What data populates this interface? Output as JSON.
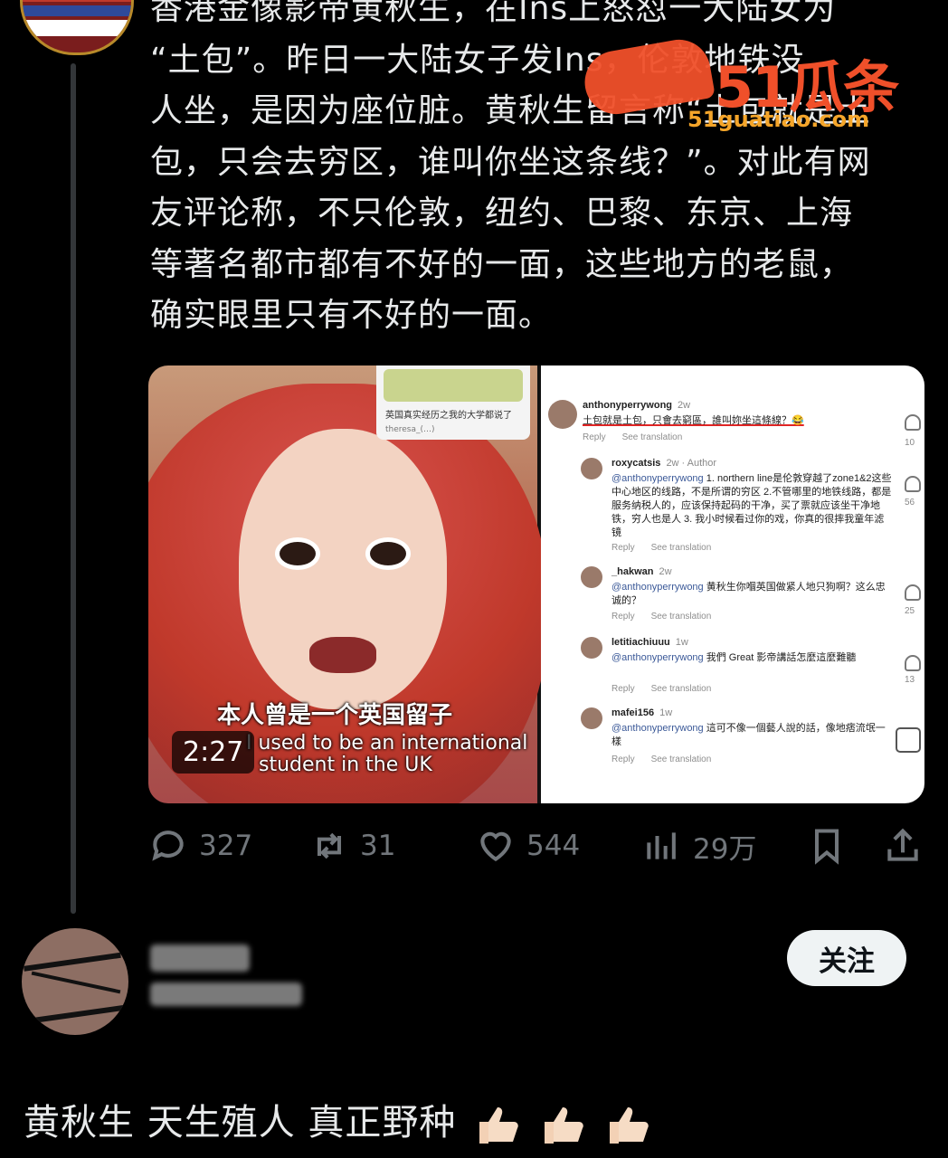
{
  "post": {
    "lines": [
      "香港金像影帝黄秋生，在Ins上怒怼一大陆女为",
      "“土包”。昨日一大陆女子发Ins，伦敦地铁没",
      "人坐，是因为座位脏。黄秋生留言称“土包就是土",
      "包，只会去穷区，谁叫你坐这条线？”。对此有网",
      "友评论称，不只伦敦，纽约、巴黎、东京、上海",
      "等著名都市都有不好的一面，这些地方的老鼠，",
      "确实眼里只有不好的一面。"
    ]
  },
  "watermark": {
    "brand": "51瓜条",
    "url": "51guatiao.com"
  },
  "video": {
    "duration": "2:27",
    "subtitle_cn": "本人曾是一个英国留子",
    "subtitle_en_1": "I used to be an international",
    "subtitle_en_2": "student in the UK",
    "mini_card_text": "英国真实经历之我的大学都说了",
    "mini_card_meta": "theresa_(…)"
  },
  "comments": [
    {
      "user": "anthonyperrywong",
      "time": "2w",
      "mention": "",
      "text": "土包就是土包，只會去窮區，誰叫妳坐這條線？😂",
      "likes": "10"
    },
    {
      "user": "roxycatsis",
      "time": "2w · Author",
      "mention": "@anthonyperrywong",
      "text": " 1. northern line是伦敦穿越了zone1&2这些中心地区的线路，不是所谓的穷区 2.不管哪里的地铁线路，都是服务纳税人的，应该保持起码的干净，买了票就应该坐干净地铁，穷人也是人 3. 我小时候看过你的戏，你真的很摔我童年滤镜",
      "likes": "56"
    },
    {
      "user": "_hakwan",
      "time": "2w",
      "mention": "@anthonyperrywong",
      "text": " 黄秋生你嗰英国做紧人地只狗啊？这么忠诚的？",
      "likes": "25"
    },
    {
      "user": "letitiachiuuu",
      "time": "1w",
      "mention": "@anthonyperrywong",
      "text": " 我們 Great 影帝講話怎麼這麼難聽",
      "likes": "13"
    },
    {
      "user": "mafei156",
      "time": "1w",
      "mention": "@anthonyperrywong",
      "text": " 這可不像一個藝人說的話，像地痞流氓一樣",
      "likes": ""
    }
  ],
  "comment_actions": {
    "reply": "Reply",
    "translate": "See translation"
  },
  "stats": {
    "replies": "327",
    "reposts": "31",
    "likes": "544",
    "views": "29万"
  },
  "reply": {
    "follow_label": "关注",
    "text": "黄秋生 天生殖人 真正野种"
  },
  "colors": {
    "background": "#000000",
    "text": "#e7e9ea",
    "muted": "#71767b",
    "watermark": "#f0502a"
  }
}
